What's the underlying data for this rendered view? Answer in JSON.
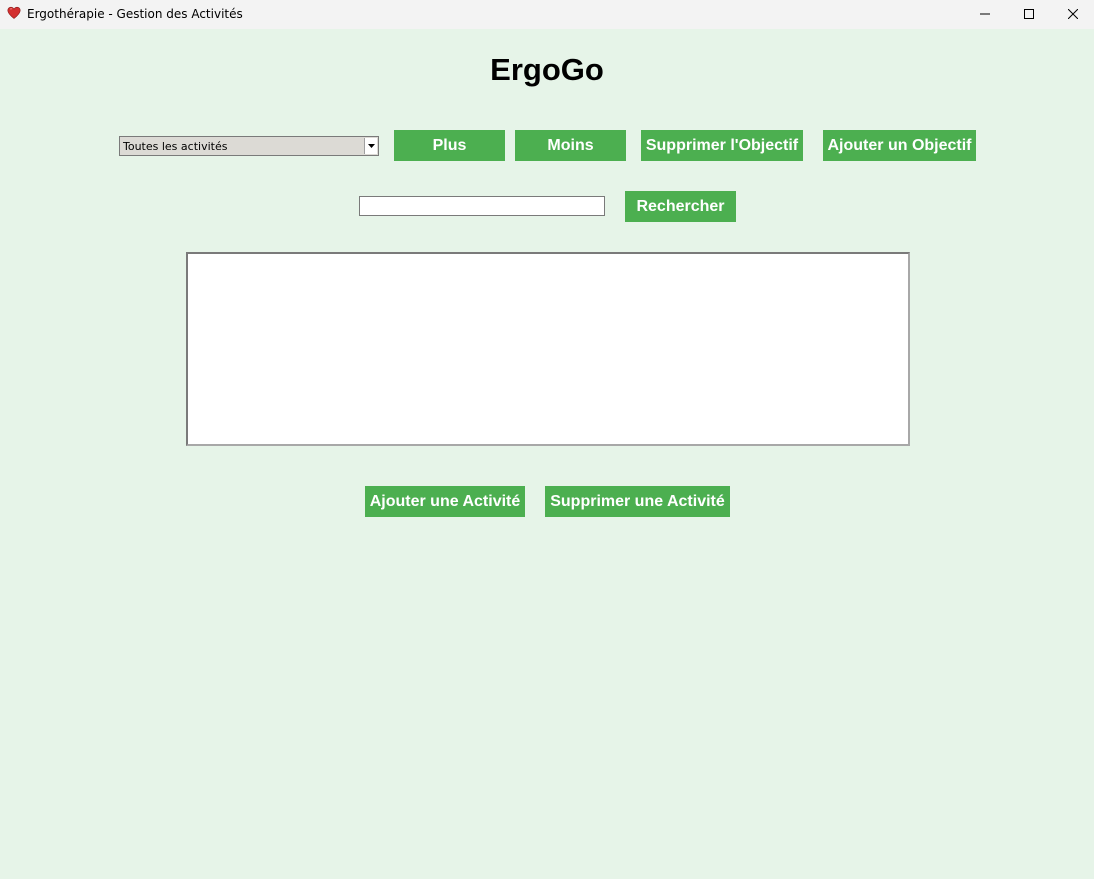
{
  "window": {
    "title": "Ergothérapie - Gestion des Activités",
    "icon": "heart-icon"
  },
  "app": {
    "title": "ErgoGo"
  },
  "filter": {
    "selected": "Toutes les activités"
  },
  "toolbar": {
    "plus_label": "Plus",
    "moins_label": "Moins",
    "delete_objective_label": "Supprimer l'Objectif",
    "add_objective_label": "Ajouter un Objectif"
  },
  "search": {
    "value": "",
    "button_label": "Rechercher"
  },
  "activities": {
    "items": []
  },
  "actions": {
    "add_activity_label": "Ajouter une Activité",
    "delete_activity_label": "Supprimer une Activité"
  },
  "colors": {
    "background": "#e6f4e8",
    "button": "#4caf50",
    "button_text": "#ffffff"
  }
}
